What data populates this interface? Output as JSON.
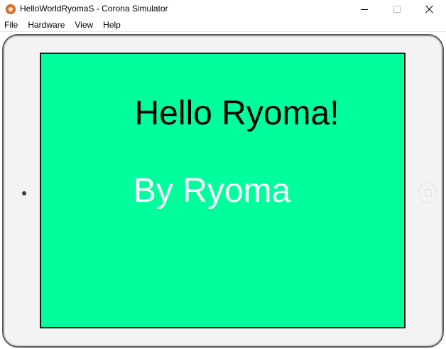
{
  "window": {
    "title": "HelloWorldRyomaS - Corona Simulator",
    "icon": "corona-app-icon",
    "controls": [
      "minimize",
      "maximize",
      "close"
    ]
  },
  "menu": {
    "items": [
      {
        "label": "File"
      },
      {
        "label": "Hardware"
      },
      {
        "label": "View"
      },
      {
        "label": "Help"
      }
    ]
  },
  "device": {
    "type": "tablet-frame",
    "screen_color": "#00ff9c",
    "hello_text": "Hello Ryoma!",
    "hello_color": "#000000",
    "by_text": "By Ryoma",
    "by_color": "#ffffff"
  }
}
